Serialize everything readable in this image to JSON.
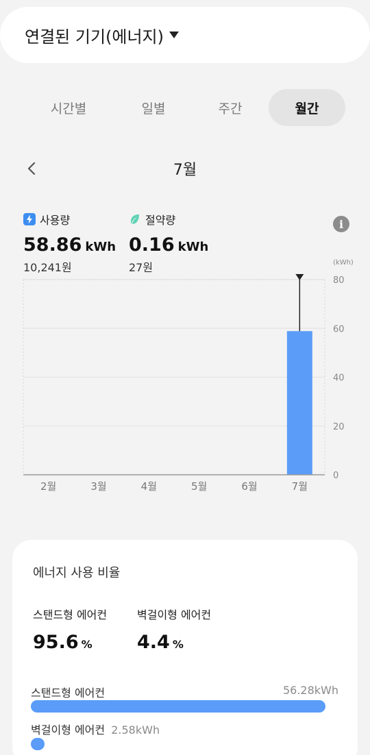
{
  "header": {
    "title": "연결된 기기(에너지)"
  },
  "tabs": [
    {
      "label": "시간별",
      "active": false
    },
    {
      "label": "일별",
      "active": false
    },
    {
      "label": "주간",
      "active": false
    },
    {
      "label": "월간",
      "active": true
    }
  ],
  "period": {
    "label": "7월"
  },
  "usage": {
    "label": "사용량",
    "value": "58.86",
    "unit": "kWh",
    "cost": "10,241원",
    "icon": "lightning-icon",
    "color": "#3d8ef0"
  },
  "saving": {
    "label": "절약량",
    "value": "0.16",
    "unit": "kWh",
    "cost": "27원",
    "icon": "leaf-icon",
    "color": "#5fd3b6"
  },
  "chart_data": {
    "type": "bar",
    "categories": [
      "2월",
      "3월",
      "4월",
      "5월",
      "6월",
      "7월"
    ],
    "values": [
      0,
      0,
      0,
      0,
      0,
      58.86
    ],
    "ylim": [
      0,
      80
    ],
    "yticks": [
      "0",
      "20",
      "40",
      "60",
      "80"
    ],
    "unit_label": "(kWh)",
    "bar_color": "#5a9cf8",
    "selected_index": 5,
    "grid": true
  },
  "ratio_card": {
    "title": "에너지 사용 비율",
    "items": [
      {
        "label": "스탠드형 에어컨",
        "percent": "95.6",
        "unit": "%"
      },
      {
        "label": "벽걸이형 에어컨",
        "percent": "4.4",
        "unit": "%"
      }
    ],
    "bars": [
      {
        "label": "스탠드형 에어컨",
        "value": "56.28kWh",
        "fraction": 0.956
      },
      {
        "label": "벽걸이형 에어컨",
        "value": "2.58kWh",
        "fraction": 0.044
      }
    ]
  }
}
